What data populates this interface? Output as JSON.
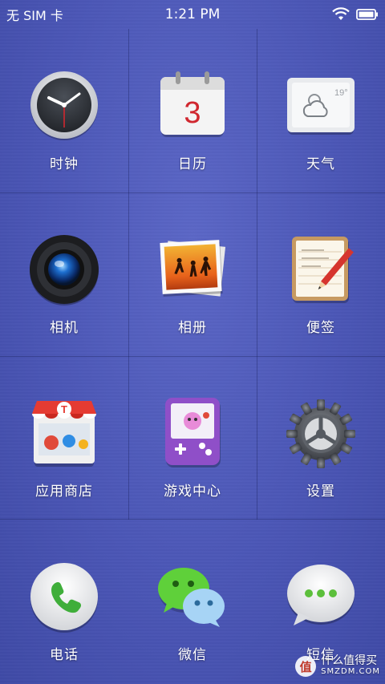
{
  "status_bar": {
    "carrier": "无 SIM 卡",
    "time": "1:21 PM",
    "wifi_icon": "wifi-icon",
    "battery_icon": "battery-icon"
  },
  "apps": [
    {
      "label": "时钟",
      "icon": "clock-icon"
    },
    {
      "label": "日历",
      "icon": "calendar-icon",
      "day": "3"
    },
    {
      "label": "天气",
      "icon": "weather-icon",
      "temp": "19°"
    },
    {
      "label": "相机",
      "icon": "camera-icon"
    },
    {
      "label": "相册",
      "icon": "photo-album-icon"
    },
    {
      "label": "便签",
      "icon": "notes-icon"
    },
    {
      "label": "应用商店",
      "icon": "app-store-icon"
    },
    {
      "label": "游戏中心",
      "icon": "game-center-icon"
    },
    {
      "label": "设置",
      "icon": "settings-gear-icon"
    }
  ],
  "dock": [
    {
      "label": "电话",
      "icon": "phone-icon"
    },
    {
      "label": "微信",
      "icon": "wechat-icon"
    },
    {
      "label": "短信",
      "icon": "sms-icon"
    }
  ],
  "watermark": {
    "badge": "值",
    "text": "什么值得买",
    "sub": "SMZDM.COM"
  },
  "colors": {
    "wallpaper": "#4b56b6",
    "grid_line": "#2a3280"
  }
}
